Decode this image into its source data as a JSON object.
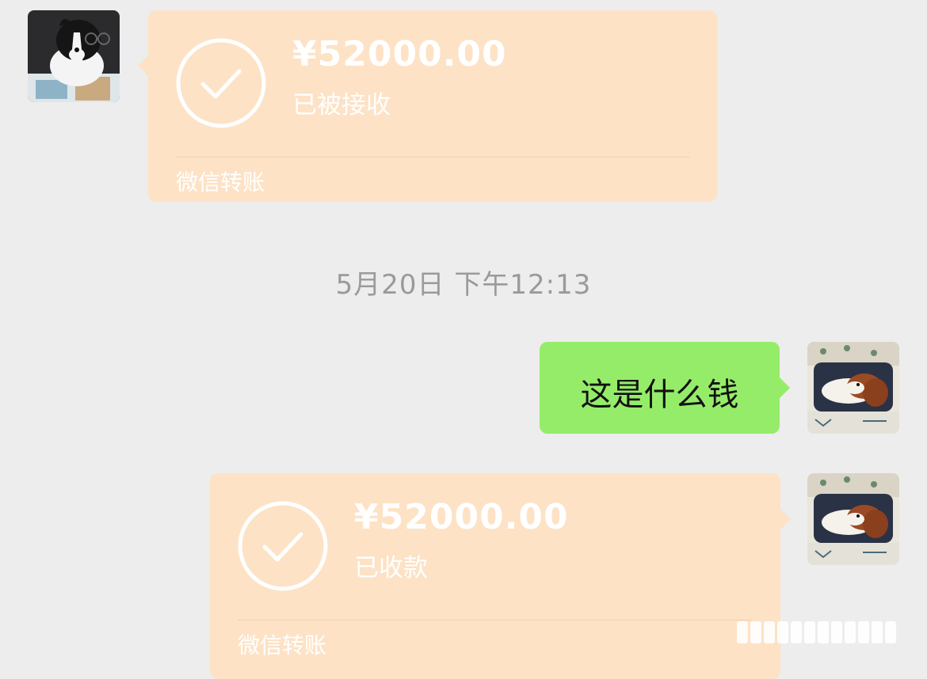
{
  "messages": {
    "transfer_received": {
      "amount": "¥52000.00",
      "status": "已被接收",
      "label": "微信转账"
    },
    "timestamp": "5月20日 下午12:13",
    "text_message": "这是什么钱",
    "transfer_collected": {
      "amount": "¥52000.00",
      "status": "已收款",
      "label": "微信转账"
    }
  },
  "colors": {
    "background": "#ededed",
    "transfer_bubble": "#fde2c6",
    "text_bubble": "#95ec69",
    "timestamp_text": "#9a9a9a"
  },
  "icons": {
    "transfer_status": "check-circle-icon",
    "sender_avatar": "dog-avatar-black-white",
    "self_avatar": "dog-avatar-brown-white"
  }
}
